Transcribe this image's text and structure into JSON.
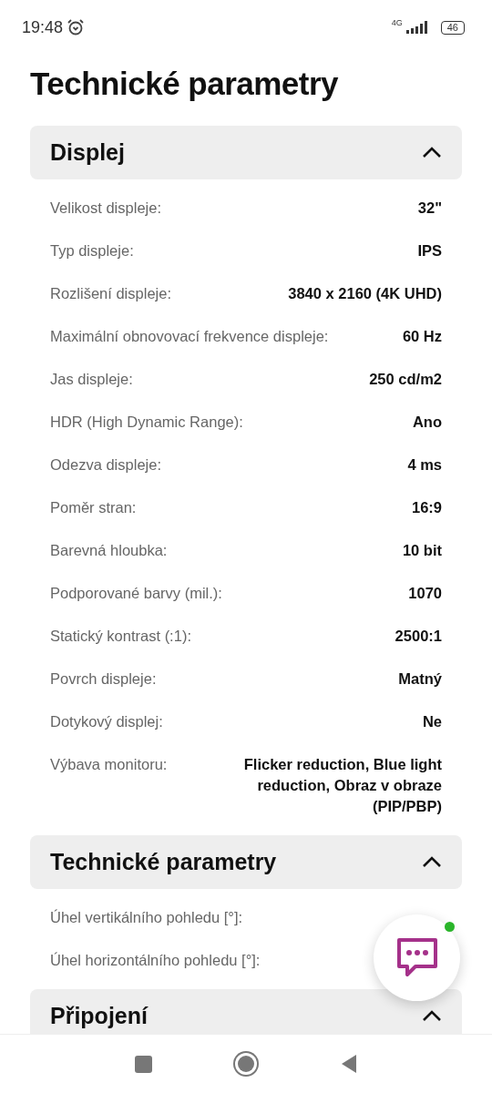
{
  "status_bar": {
    "time": "19:48",
    "network": "4G",
    "battery": "46"
  },
  "title": "Technické parametry",
  "sections": [
    {
      "title": "Displej",
      "expanded": true,
      "rows": [
        {
          "label": "Velikost displeje:",
          "value": "32\""
        },
        {
          "label": "Typ displeje:",
          "value": "IPS"
        },
        {
          "label": "Rozlišení displeje:",
          "value": "3840 x 2160 (4K UHD)"
        },
        {
          "label": "Maximální obnovovací frekvence displeje:",
          "value": "60 Hz"
        },
        {
          "label": "Jas displeje:",
          "value": "250 cd/m2"
        },
        {
          "label": "HDR (High Dynamic Range):",
          "value": "Ano"
        },
        {
          "label": "Odezva displeje:",
          "value": "4 ms"
        },
        {
          "label": "Poměr stran:",
          "value": "16:9"
        },
        {
          "label": "Barevná hloubka:",
          "value": "10 bit"
        },
        {
          "label": "Podporované barvy (mil.):",
          "value": "1070"
        },
        {
          "label": "Statický kontrast (:1):",
          "value": "2500:1"
        },
        {
          "label": "Povrch displeje:",
          "value": "Matný"
        },
        {
          "label": "Dotykový displej:",
          "value": "Ne"
        },
        {
          "label": "Výbava monitoru:",
          "value": "Flicker reduction, Blue light reduction, Obraz v obraze (PIP/PBP)"
        }
      ]
    },
    {
      "title": "Technické parametry",
      "expanded": true,
      "rows": [
        {
          "label": "Úhel vertikálního pohledu [°]:"
        },
        {
          "label": "Úhel horizontálního pohledu [°]:"
        }
      ]
    },
    {
      "title": "Připojení",
      "expanded": true
    }
  ],
  "chat_button": {
    "online": true
  }
}
